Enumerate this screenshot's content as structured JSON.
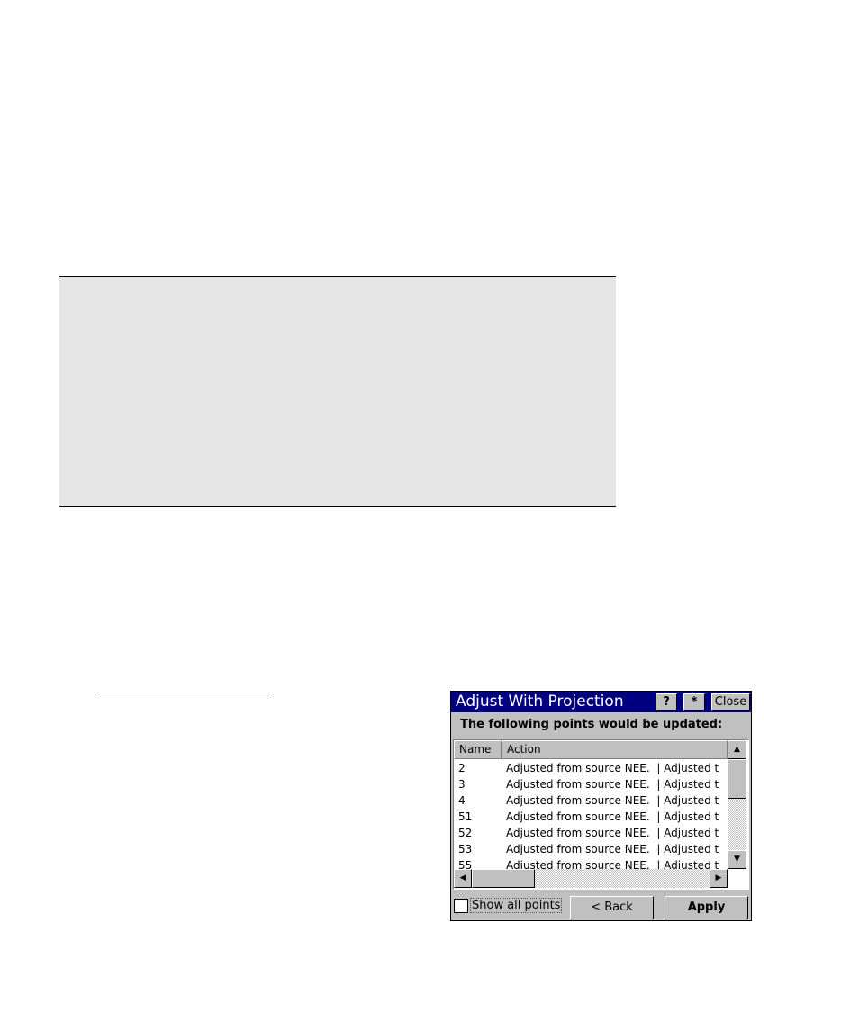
{
  "dialog": {
    "title": "Adjust With Projection",
    "help_label": "?",
    "star_label": "*",
    "close_label": "Close",
    "subtitle": "The following points would be updated:",
    "columns": [
      "Name",
      "Action"
    ],
    "rows": [
      {
        "name": "2",
        "action": "Adjusted from source NEE.  | Adjusted t"
      },
      {
        "name": "3",
        "action": "Adjusted from source NEE.  | Adjusted t"
      },
      {
        "name": "4",
        "action": "Adjusted from source NEE.  | Adjusted t"
      },
      {
        "name": "51",
        "action": "Adjusted from source NEE.  | Adjusted t"
      },
      {
        "name": "52",
        "action": "Adjusted from source NEE.  | Adjusted t"
      },
      {
        "name": "53",
        "action": "Adjusted from source NEE.  | Adjusted t"
      },
      {
        "name": "55",
        "action": "Adjusted from source NEE.  | Adjusted t"
      }
    ],
    "show_all_label": "Show all points",
    "show_all_checked": false,
    "back_label": "< Back",
    "apply_label": "Apply"
  }
}
